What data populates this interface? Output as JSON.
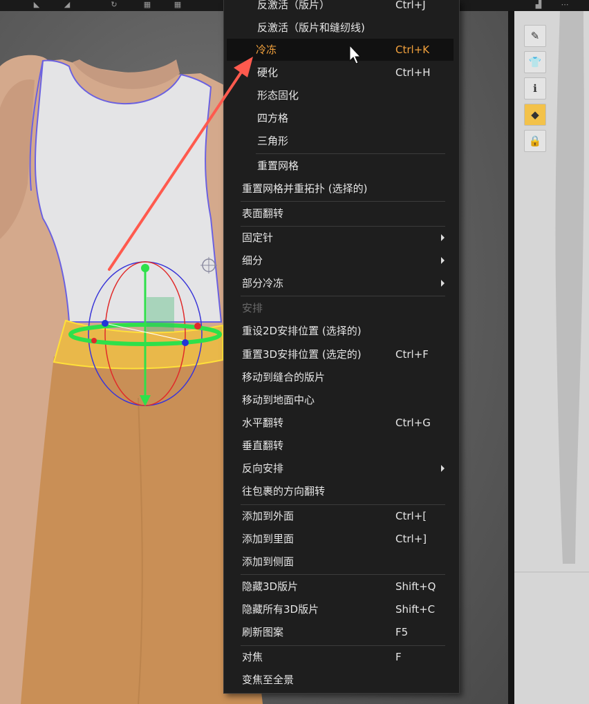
{
  "menu": {
    "items": [
      {
        "label": "反激活（版片）",
        "shortcut": "Ctrl+J"
      },
      {
        "label": "反激活（版片和缝纫线)",
        "shortcut": ""
      },
      {
        "label": "冷冻",
        "shortcut": "Ctrl+K"
      },
      {
        "label": "硬化",
        "shortcut": "Ctrl+H"
      },
      {
        "label": "形态固化",
        "shortcut": ""
      },
      {
        "label": "四方格",
        "shortcut": ""
      },
      {
        "label": "三角形",
        "shortcut": ""
      },
      {
        "label": "重置网格",
        "shortcut": ""
      },
      {
        "label": "重置网格并重拓扑 (选择的)",
        "shortcut": ""
      },
      {
        "label": "表面翻转",
        "shortcut": ""
      },
      {
        "label": "固定针",
        "shortcut": ""
      },
      {
        "label": "细分",
        "shortcut": ""
      },
      {
        "label": "部分冷冻",
        "shortcut": ""
      },
      {
        "label": "安排",
        "shortcut": ""
      },
      {
        "label": "重设2D安排位置 (选择的)",
        "shortcut": ""
      },
      {
        "label": "重置3D安排位置 (选定的)",
        "shortcut": "Ctrl+F"
      },
      {
        "label": "移动到缝合的版片",
        "shortcut": ""
      },
      {
        "label": "移动到地面中心",
        "shortcut": ""
      },
      {
        "label": "水平翻转",
        "shortcut": "Ctrl+G"
      },
      {
        "label": "垂直翻转",
        "shortcut": ""
      },
      {
        "label": "反向安排",
        "shortcut": ""
      },
      {
        "label": "往包裹的方向翻转",
        "shortcut": ""
      },
      {
        "label": "添加到外面",
        "shortcut": "Ctrl+["
      },
      {
        "label": "添加到里面",
        "shortcut": "Ctrl+]"
      },
      {
        "label": "添加到侧面",
        "shortcut": ""
      },
      {
        "label": "隐藏3D版片",
        "shortcut": "Shift+Q"
      },
      {
        "label": "隐藏所有3D版片",
        "shortcut": "Shift+C"
      },
      {
        "label": "刷新图案",
        "shortcut": "F5"
      },
      {
        "label": "对焦",
        "shortcut": "F"
      },
      {
        "label": "变焦至全景",
        "shortcut": ""
      }
    ]
  },
  "colors": {
    "highlight": "#f3a23d",
    "annotation_arrow": "#ff5a4e",
    "skirt": "#c98f56",
    "waistband": "#e9b84a",
    "gizmo_green": "#2ee04a",
    "gizmo_red": "#e02a2a",
    "gizmo_blue": "#3a36d8"
  },
  "panel": {
    "tools": [
      "brush-eye-icon",
      "shirt-eye-icon",
      "info-icon",
      "texture-icon",
      "lock-shirt-icon"
    ]
  }
}
